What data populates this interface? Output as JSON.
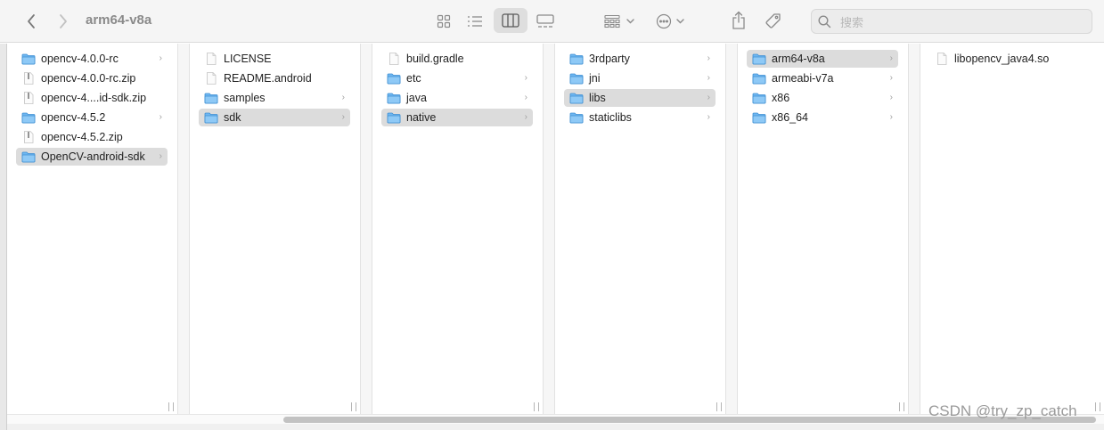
{
  "window": {
    "title": "arm64-v8a"
  },
  "search": {
    "placeholder": "搜索"
  },
  "icons": {
    "back": "chevron-left-icon",
    "forward": "chevron-right-icon",
    "icon_view": "grid-icon",
    "list_view": "list-icon",
    "column_view": "columns-icon",
    "gallery_view": "gallery-icon",
    "group": "group-icon",
    "action": "ellipsis-icon",
    "share": "share-icon",
    "tag": "tag-icon",
    "search": "search-icon"
  },
  "colors": {
    "folder": "#6fb7f1",
    "selection": "#dcdcdc"
  },
  "columns": [
    {
      "items": [
        {
          "label": "opencv-4.0.0-rc",
          "kind": "folder",
          "chevron": "›"
        },
        {
          "label": "opencv-4.0.0-rc.zip",
          "kind": "zip"
        },
        {
          "label": "opencv-4....id-sdk.zip",
          "kind": "zip"
        },
        {
          "label": "opencv-4.5.2",
          "kind": "folder",
          "chevron": "›"
        },
        {
          "label": "opencv-4.5.2.zip",
          "kind": "zip"
        },
        {
          "label": "OpenCV-android-sdk",
          "kind": "folder",
          "chevron": "›",
          "selected": true
        }
      ]
    },
    {
      "items": [
        {
          "label": "LICENSE",
          "kind": "file"
        },
        {
          "label": "README.android",
          "kind": "file"
        },
        {
          "label": "samples",
          "kind": "folder",
          "chevron": "›"
        },
        {
          "label": "sdk",
          "kind": "folder",
          "chevron": "›",
          "selected": true
        }
      ]
    },
    {
      "items": [
        {
          "label": "build.gradle",
          "kind": "file"
        },
        {
          "label": "etc",
          "kind": "folder",
          "chevron": "›"
        },
        {
          "label": "java",
          "kind": "folder",
          "chevron": "›"
        },
        {
          "label": "native",
          "kind": "folder",
          "chevron": "›",
          "selected": true
        }
      ]
    },
    {
      "items": [
        {
          "label": "3rdparty",
          "kind": "folder",
          "chevron": "›"
        },
        {
          "label": "jni",
          "kind": "folder",
          "chevron": "›"
        },
        {
          "label": "libs",
          "kind": "folder",
          "chevron": "›",
          "selected": true
        },
        {
          "label": "staticlibs",
          "kind": "folder",
          "chevron": "›"
        }
      ]
    },
    {
      "items": [
        {
          "label": "arm64-v8a",
          "kind": "folder",
          "chevron": "›",
          "selected": true
        },
        {
          "label": "armeabi-v7a",
          "kind": "folder",
          "chevron": "›"
        },
        {
          "label": "x86",
          "kind": "folder",
          "chevron": "›"
        },
        {
          "label": "x86_64",
          "kind": "folder",
          "chevron": "›"
        }
      ]
    },
    {
      "items": [
        {
          "label": "libopencv_java4.so",
          "kind": "file"
        }
      ]
    }
  ],
  "watermark": "CSDN @try_zp_catch"
}
